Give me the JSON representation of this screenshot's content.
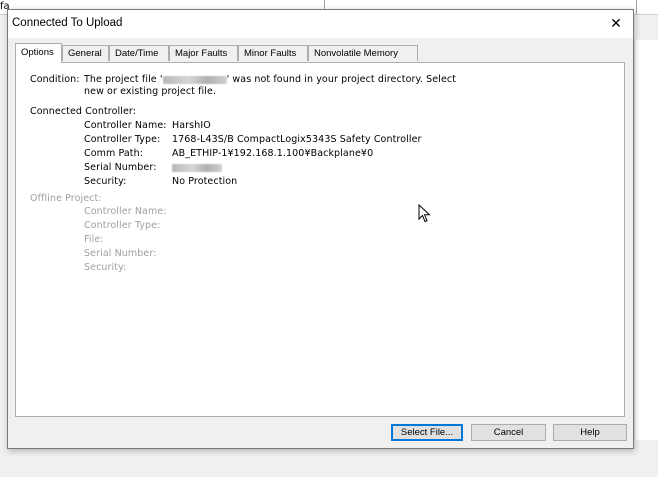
{
  "background": {
    "fragment": "fa"
  },
  "dialog": {
    "title": "Connected To Upload",
    "close_glyph": "✕"
  },
  "tabs": [
    {
      "label": "Options",
      "active": true
    },
    {
      "label": "General",
      "active": false
    },
    {
      "label": "Date/Time",
      "active": false
    },
    {
      "label": "Major Faults",
      "active": false
    },
    {
      "label": "Minor Faults",
      "active": false
    },
    {
      "label": "Nonvolatile Memory",
      "active": false
    }
  ],
  "options": {
    "condition_label": "Condition:",
    "condition_text_1a": "The project file '",
    "condition_text_1b": "' was not found in your project directory. Select",
    "condition_text_2": "new or existing project file.",
    "connected_header": "Connected Controller:",
    "connected": {
      "name_label": "Controller Name:",
      "name_value": "HarshIO",
      "type_label": "Controller Type:",
      "type_value": "1768-L43S/B CompactLogix5343S Safety Controller",
      "path_label": "Comm Path:",
      "path_value": "AB_ETHIP-1¥192.168.1.100¥Backplane¥0",
      "serial_label": "Serial Number:",
      "security_label": "Security:",
      "security_value": "No Protection"
    },
    "offline_header": "Offline Project:",
    "offline": {
      "name_label": "Controller Name:",
      "type_label": "Controller Type:",
      "file_label": "File:",
      "serial_label": "Serial Number:",
      "security_label": "Security:"
    }
  },
  "buttons": {
    "select_file": "Select File...",
    "cancel": "Cancel",
    "help": "Help"
  },
  "colors": {
    "accent": "#0078d7",
    "disabled_text": "#a0a0a0"
  },
  "icons": {
    "cursor": "mouse-pointer-icon",
    "close": "close-icon"
  }
}
